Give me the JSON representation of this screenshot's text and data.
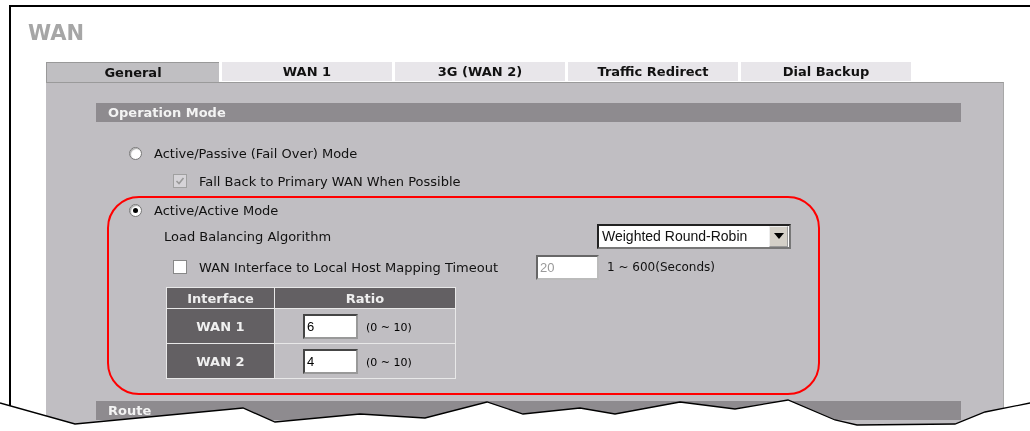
{
  "page_title": "WAN",
  "tabs": [
    {
      "label": "General",
      "selected": true
    },
    {
      "label": "WAN 1",
      "selected": false
    },
    {
      "label": "3G (WAN 2)",
      "selected": false
    },
    {
      "label": "Traffic Redirect",
      "selected": false
    },
    {
      "label": "Dial Backup",
      "selected": false
    }
  ],
  "section": {
    "title": "Operation Mode"
  },
  "modes": [
    {
      "label": "Active/Passive (Fail Over) Mode",
      "selected": false
    },
    {
      "label": "Active/Active Mode",
      "selected": true
    }
  ],
  "fall_back": {
    "label": "Fall Back to Primary WAN When Possible",
    "checked": true,
    "disabled": true
  },
  "algorithm": {
    "label": "Load Balancing Algorithm",
    "value": "Weighted Round-Robin"
  },
  "timeout": {
    "label": "WAN Interface to Local Host Mapping Timeout",
    "checked": false,
    "value": "20",
    "disabled": true,
    "range": "1 ~ 600(Seconds)"
  },
  "ratio_table": {
    "columns": [
      "Interface",
      "Ratio"
    ],
    "rows": [
      {
        "interface": "WAN 1",
        "ratio": "6",
        "range": "(0 ~ 10)"
      },
      {
        "interface": "WAN 2",
        "ratio": "4",
        "range": "(0 ~ 10)"
      }
    ]
  },
  "next_section": {
    "title": "Route"
  }
}
